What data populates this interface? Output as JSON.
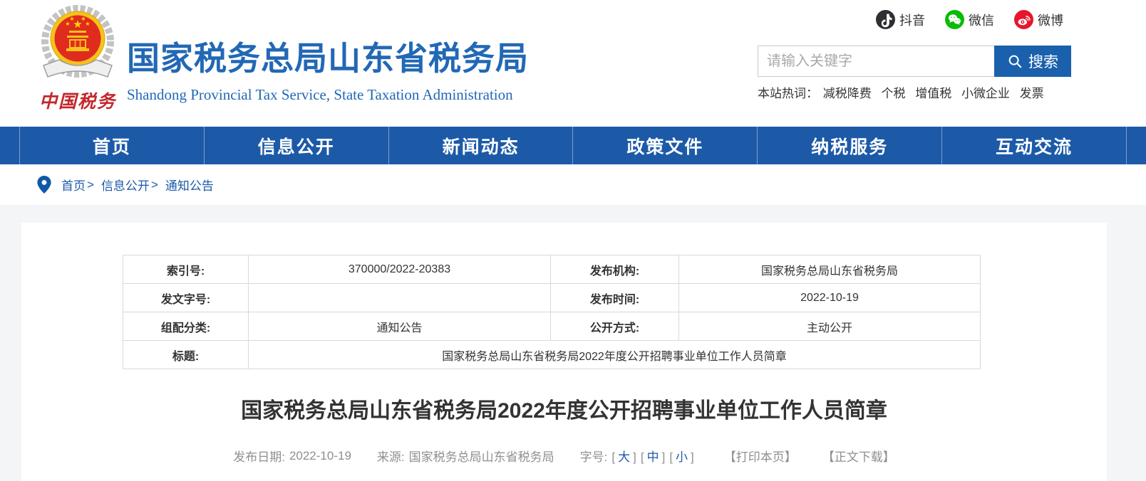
{
  "colors": {
    "accent_blue": "#1c5aa8",
    "title_blue": "#2268b5",
    "search_button_bg": "#1a60ad",
    "douyin_bg": "#2e2e33",
    "wechat_bg": "#09bb07",
    "weibo_bg": "#e6162d",
    "text_dark": "#333333",
    "meta_gray": "#8f8f8f",
    "table_border": "#d9d9d9",
    "page_bg": "#f4f5f6"
  },
  "header": {
    "logo_caption": "中国税务",
    "site_title": "国家税务总局山东省税务局",
    "site_subtitle": "Shandong Provincial Tax Service, State Taxation Administration",
    "social": {
      "douyin": "抖音",
      "wechat": "微信",
      "weibo": "微博"
    },
    "search": {
      "placeholder": "请输入关键字",
      "button": "搜索"
    },
    "hotwords": {
      "label": "本站热词：",
      "words": [
        "减税降费",
        "个税",
        "增值税",
        "小微企业",
        "发票"
      ]
    }
  },
  "nav": {
    "items": [
      "首页",
      "信息公开",
      "新闻动态",
      "政策文件",
      "纳税服务",
      "互动交流"
    ]
  },
  "breadcrumb": {
    "separator": ">",
    "items": [
      "首页",
      "信息公开",
      "通知公告"
    ]
  },
  "info_table": {
    "rows": [
      {
        "c1": "索引号:",
        "v1": "370000/2022-20383",
        "c2": "发布机构:",
        "v2": "国家税务总局山东省税务局"
      },
      {
        "c1": "发文字号:",
        "v1": "",
        "c2": "发布时间:",
        "v2": "2022-10-19"
      },
      {
        "c1": "组配分类:",
        "v1": "通知公告",
        "c2": "公开方式:",
        "v2": "主动公开"
      },
      {
        "c1": "标题:",
        "v1": "国家税务总局山东省税务局2022年度公开招聘事业单位工作人员简章"
      }
    ]
  },
  "article": {
    "title": "国家税务总局山东省税务局2022年度公开招聘事业单位工作人员简章",
    "meta": {
      "date_label": "发布日期:",
      "date": "2022-10-19",
      "source_label": "来源:",
      "source": "国家税务总局山东省税务局",
      "fontsize_label": "字号:",
      "sizes": [
        "大",
        "中",
        "小"
      ],
      "brackets": {
        "open": "[",
        "close": "]"
      },
      "print": "【打印本页】",
      "download": "【正文下载】"
    }
  }
}
